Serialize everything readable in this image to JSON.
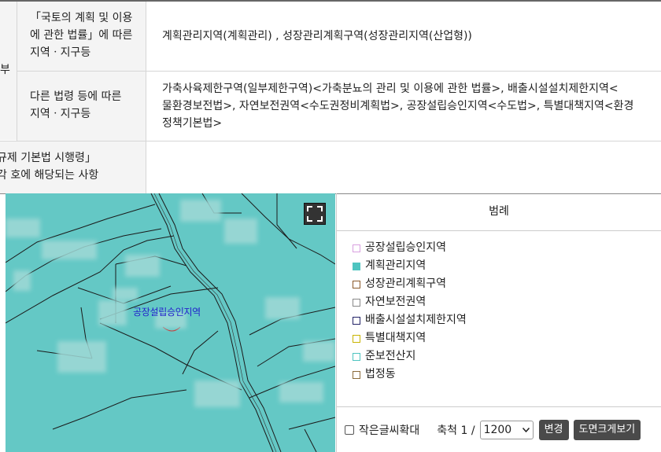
{
  "table": {
    "row1_left_fragment": "부",
    "row1a": {
      "header_line1": "「국토의 계획 및 이용",
      "header_line2": "에 관한 법률」에 따른",
      "header_line3": "지역ㆍ지구등",
      "value": "계획관리지역(계획관리) , 성장관리계획구역(성장관리지역(산업형))"
    },
    "row1b": {
      "header_line1": "다른 법령 등에 따른",
      "header_line2": "지역ㆍ지구등",
      "value_line1": "가축사육제한구역(일부제한구역)<가축분뇨의 관리 및 이용에 관한 법률>, 배출시설설치제한지역<",
      "value_line2": "물환경보전법>, 자연보전권역<수도권정비계획법>, 공장설립승인지역<수도법>, 특별대책지역<환경",
      "value_line3": "정책기본법>"
    },
    "row2": {
      "header_line1": "규제 기본법 시행령」",
      "header_line2": "각 호에 해당되는 사항",
      "value": ""
    }
  },
  "map": {
    "label": "공장설립승인지역",
    "expand_icon": "fullscreen-icon"
  },
  "legend": {
    "title": "범례",
    "items": [
      {
        "label": "공장설립승인지역",
        "color": "#d9a0e0",
        "fill": "#ffffff"
      },
      {
        "label": "계획관리지역",
        "color": "#4ec4c0",
        "fill": "#4ec4c0"
      },
      {
        "label": "성장관리계획구역",
        "color": "#8b5a2b",
        "fill": "#ffffff"
      },
      {
        "label": "자연보전권역",
        "color": "#888888",
        "fill": "#ffffff"
      },
      {
        "label": "배출시설설치제한지역",
        "color": "#222266",
        "fill": "#ffffff"
      },
      {
        "label": "특별대책지역",
        "color": "#c8b400",
        "fill": "#ffffff"
      },
      {
        "label": "준보전산지",
        "color": "#4ec4c0",
        "fill": "#ffffff"
      },
      {
        "label": "법정동",
        "color": "#8b6b3b",
        "fill": "#ffffff"
      }
    ]
  },
  "controls": {
    "small_text_zoom_label": "작은글씨확대",
    "scale_label": "축척 1 /",
    "scale_value": "1200",
    "change_button": "변경",
    "print_button": "도면크게보기"
  }
}
